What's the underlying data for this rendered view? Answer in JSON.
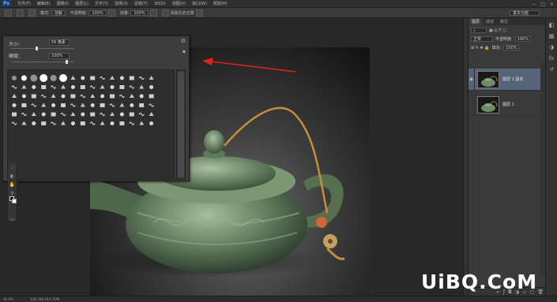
{
  "app": {
    "logo": "Ps"
  },
  "menu": [
    "文件(F)",
    "编辑(E)",
    "图像(I)",
    "图层(L)",
    "文字(Y)",
    "选择(S)",
    "滤镜(T)",
    "3D(D)",
    "视图(V)",
    "窗口(W)",
    "帮助(H)"
  ],
  "window_controls": [
    "−",
    "□",
    "×"
  ],
  "options": {
    "mode_label": "模式:",
    "mode_value": "溶解",
    "opacity_label": "不透明度:",
    "opacity_value": "100%",
    "flow_label": "流量:",
    "flow_value": "100%",
    "smoothing_label": "清除历史记录",
    "workspace_value": "基本功能"
  },
  "brush_panel": {
    "size_label": "大小:",
    "size_value": "55 像素",
    "size_fraction": 0.4,
    "hardness_label": "硬度:",
    "hardness_value": "100%",
    "hardness_fraction": 1.0
  },
  "layers_panel": {
    "tabs": [
      "图层",
      "通道",
      "路径"
    ],
    "blend_mode": "正常",
    "opacity_label": "不透明度:",
    "opacity_value": "100%",
    "fill_label": "填充:",
    "fill_value": "100%",
    "layers": [
      {
        "name": "图层 1 副本",
        "selected": true
      },
      {
        "name": "图层 1",
        "selected": false
      }
    ]
  },
  "statusbar": {
    "zoom": "46.9%",
    "doc": "文档:788.2K/1.93M"
  },
  "watermark": "UiBQ.CoM",
  "colors": {
    "annotation_arrow": "#e0231a",
    "selected_layer": "#56647a",
    "watermark": "#ffffff"
  }
}
